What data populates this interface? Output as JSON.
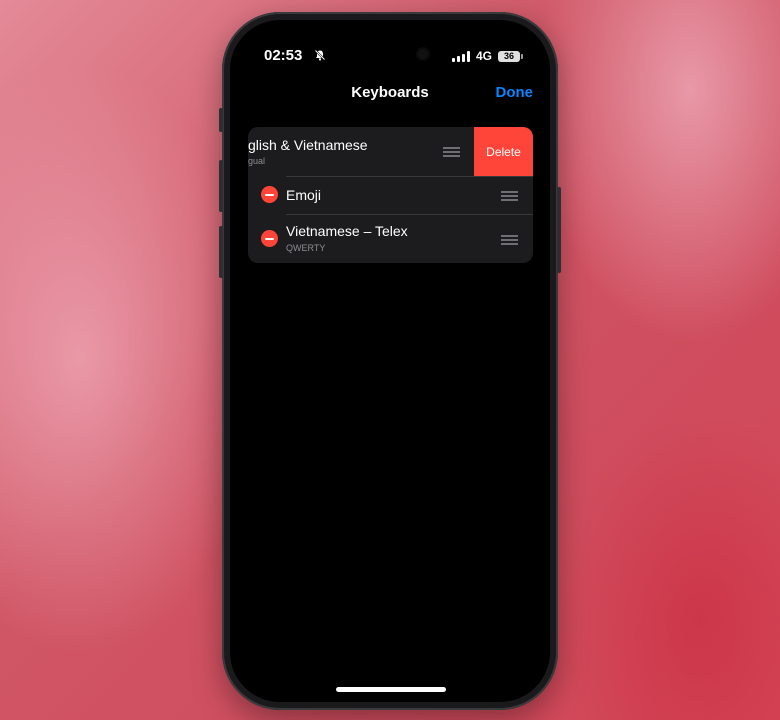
{
  "status_bar": {
    "time": "02:53",
    "network": "4G",
    "battery": "36"
  },
  "nav": {
    "title": "Keyboards",
    "done_label": "Done"
  },
  "keyboards": [
    {
      "name": "glish & Vietnamese",
      "subtitle": "gual",
      "swiped": true
    },
    {
      "name": "Emoji",
      "subtitle": ""
    },
    {
      "name": "Vietnamese – Telex",
      "subtitle": "QWERTY"
    }
  ],
  "delete_label": "Delete",
  "colors": {
    "accent": "#0a84ff",
    "delete": "#ff453a"
  }
}
